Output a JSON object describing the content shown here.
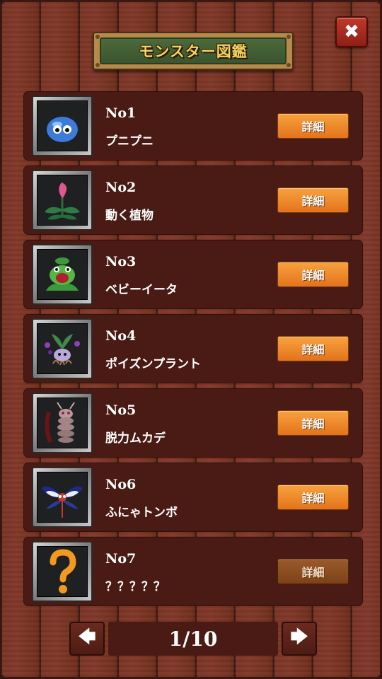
{
  "title": "モンスター図鑑",
  "close_label": "✖",
  "entries": [
    {
      "no": "No1",
      "name": "プニプニ",
      "detail": "詳細",
      "icon": "blue-slime-icon"
    },
    {
      "no": "No2",
      "name": "動く植物",
      "detail": "詳細",
      "icon": "pink-flower-plant-icon"
    },
    {
      "no": "No3",
      "name": "ベビーイータ",
      "detail": "詳細",
      "icon": "green-venus-flytrap-icon"
    },
    {
      "no": "No4",
      "name": "ポイズンプラント",
      "detail": "詳細",
      "icon": "poison-plant-icon"
    },
    {
      "no": "No5",
      "name": "脱力ムカデ",
      "detail": "詳細",
      "icon": "centipede-icon"
    },
    {
      "no": "No6",
      "name": "ふにゃトンボ",
      "detail": "詳細",
      "icon": "dragonfly-icon"
    },
    {
      "no": "No7",
      "name": "？？？？？",
      "detail": "詳細",
      "icon": "question-mark-icon"
    }
  ],
  "pagination": {
    "prev": "🡄",
    "next": "🡆",
    "page": "1/10"
  },
  "colors": {
    "detail_button": "#f39530",
    "detail_disabled": "#8b4c20",
    "title_text": "#f4d35e",
    "title_plate": "#4c6a3a"
  }
}
